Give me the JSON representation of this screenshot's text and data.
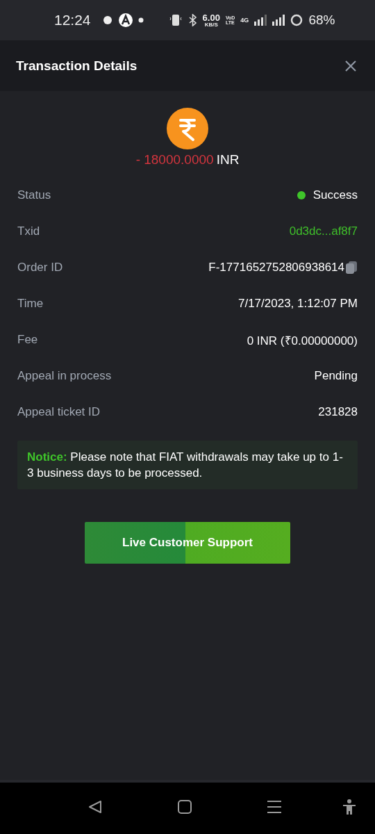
{
  "status_bar": {
    "time": "12:24",
    "speed": "6.00",
    "speed_unit": "KB/S",
    "carrier_top": "VoD",
    "carrier_bottom": "LTE",
    "network": "4G",
    "battery": "68%"
  },
  "header": {
    "title": "Transaction Details"
  },
  "amount": {
    "value": "- 18000.0000",
    "currency": "INR"
  },
  "rows": [
    {
      "label": "Status",
      "value": "Success",
      "kind": "status",
      "color": "#3fc52a"
    },
    {
      "label": "Txid",
      "value": "0d3dc...af8f7",
      "kind": "link"
    },
    {
      "label": "Order ID",
      "value": "F-1771652752806938614",
      "kind": "copy"
    },
    {
      "label": "Time",
      "value": "7/17/2023, 1:12:07 PM",
      "kind": "plain"
    },
    {
      "label": "Fee",
      "value": "0 INR (₹0.00000000)",
      "kind": "plain"
    },
    {
      "label": "Appeal in process",
      "value": "Pending",
      "kind": "plain"
    },
    {
      "label": "Appeal ticket ID",
      "value": "231828",
      "kind": "plain"
    }
  ],
  "notice": {
    "label": "Notice:",
    "text": "Please note that FIAT withdrawals may take up to 1-3 business days to be processed."
  },
  "support_button": {
    "label": "Live Customer Support"
  }
}
